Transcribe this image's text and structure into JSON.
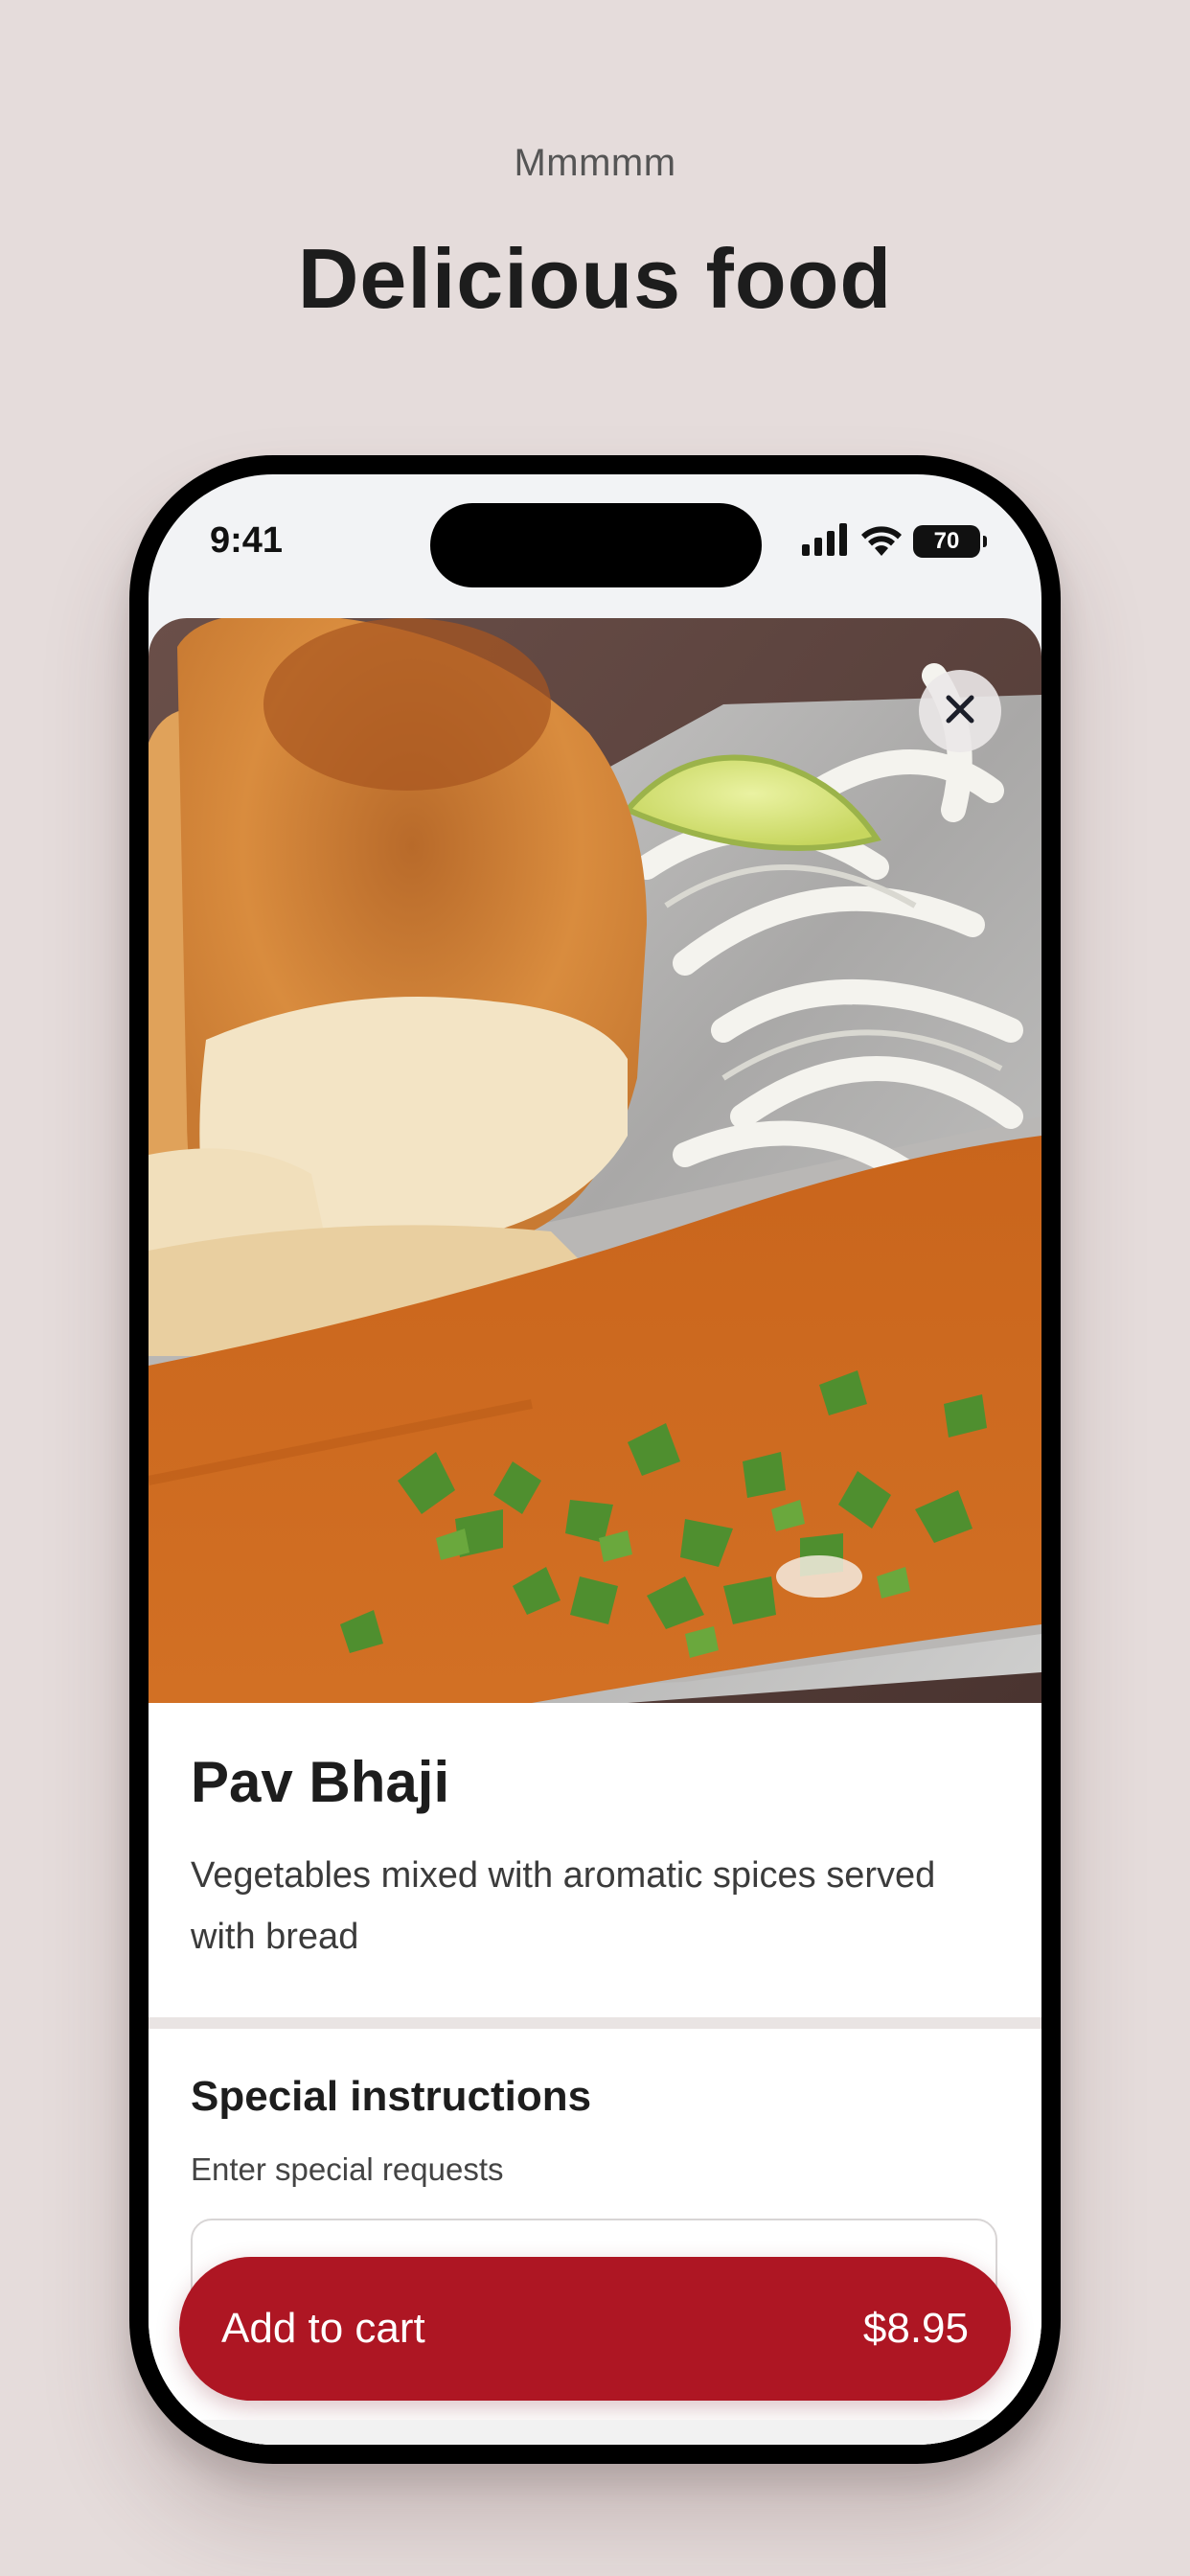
{
  "promo": {
    "eyebrow": "Mmmmm",
    "headline": "Delicious food"
  },
  "status_bar": {
    "time": "9:41",
    "battery": "70"
  },
  "dish": {
    "name": "Pav Bhaji",
    "description": "Vegetables mixed with aromatic spices served with bread"
  },
  "special_instructions": {
    "title": "Special instructions",
    "subtitle": "Enter special requests",
    "value": ""
  },
  "cart": {
    "label": "Add to cart",
    "price": "$8.95"
  },
  "icons": {
    "close": "close-icon",
    "signal": "cellular-signal-icon",
    "wifi": "wifi-icon",
    "battery": "battery-icon"
  },
  "colors": {
    "background": "#e5dcdb",
    "accent": "#ae1623",
    "phone_frame": "#000000"
  }
}
